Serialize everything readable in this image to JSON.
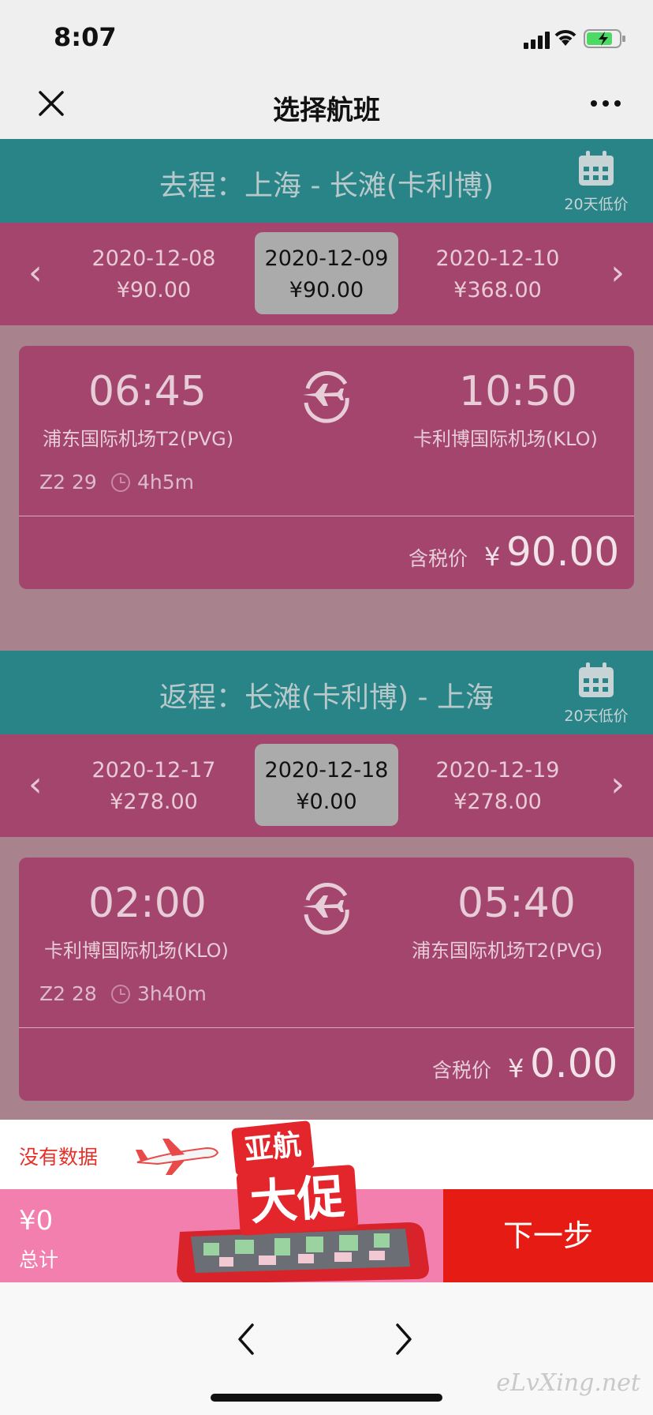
{
  "status_bar": {
    "time": "8:07"
  },
  "nav": {
    "title": "选择航班"
  },
  "outbound": {
    "title": "去程：上海 - 长滩(卡利博)",
    "calendar_label": "20天低价",
    "dates": [
      {
        "date": "2020-12-08",
        "price": "¥90.00"
      },
      {
        "date": "2020-12-09",
        "price": "¥90.00",
        "selected": true
      },
      {
        "date": "2020-12-10",
        "price": "¥368.00"
      }
    ],
    "flight": {
      "depart_time": "06:45",
      "depart_airport": "浦东国际机场T2(PVG)",
      "arrive_time": "10:50",
      "arrive_airport": "卡利博国际机场(KLO)",
      "flight_no": "Z2 29",
      "duration": "4h5m",
      "tax_label": "含税价",
      "currency": "¥",
      "price": "90.00"
    }
  },
  "return": {
    "title": "返程：长滩(卡利博) - 上海",
    "calendar_label": "20天低价",
    "dates": [
      {
        "date": "2020-12-17",
        "price": "¥278.00"
      },
      {
        "date": "2020-12-18",
        "price": "¥0.00",
        "selected": true
      },
      {
        "date": "2020-12-19",
        "price": "¥278.00"
      }
    ],
    "flight": {
      "depart_time": "02:00",
      "depart_airport": "卡利博国际机场(KLO)",
      "arrive_time": "05:40",
      "arrive_airport": "浦东国际机场T2(PVG)",
      "flight_no": "Z2 28",
      "duration": "3h40m",
      "tax_label": "含税价",
      "currency": "¥",
      "price": "0.00"
    }
  },
  "footer": {
    "no_data": "没有数据",
    "total_amount": "¥0",
    "total_label": "总计",
    "next_button": "下一步",
    "promo_line1": "亚航",
    "promo_line2": "大促"
  },
  "watermark": "eLvXing.net",
  "colors": {
    "section_header": "#288487",
    "date_strip": "#a3456d",
    "card": "#a3456d",
    "next_button": "#e51b14",
    "total_bar": "#f27fae"
  }
}
